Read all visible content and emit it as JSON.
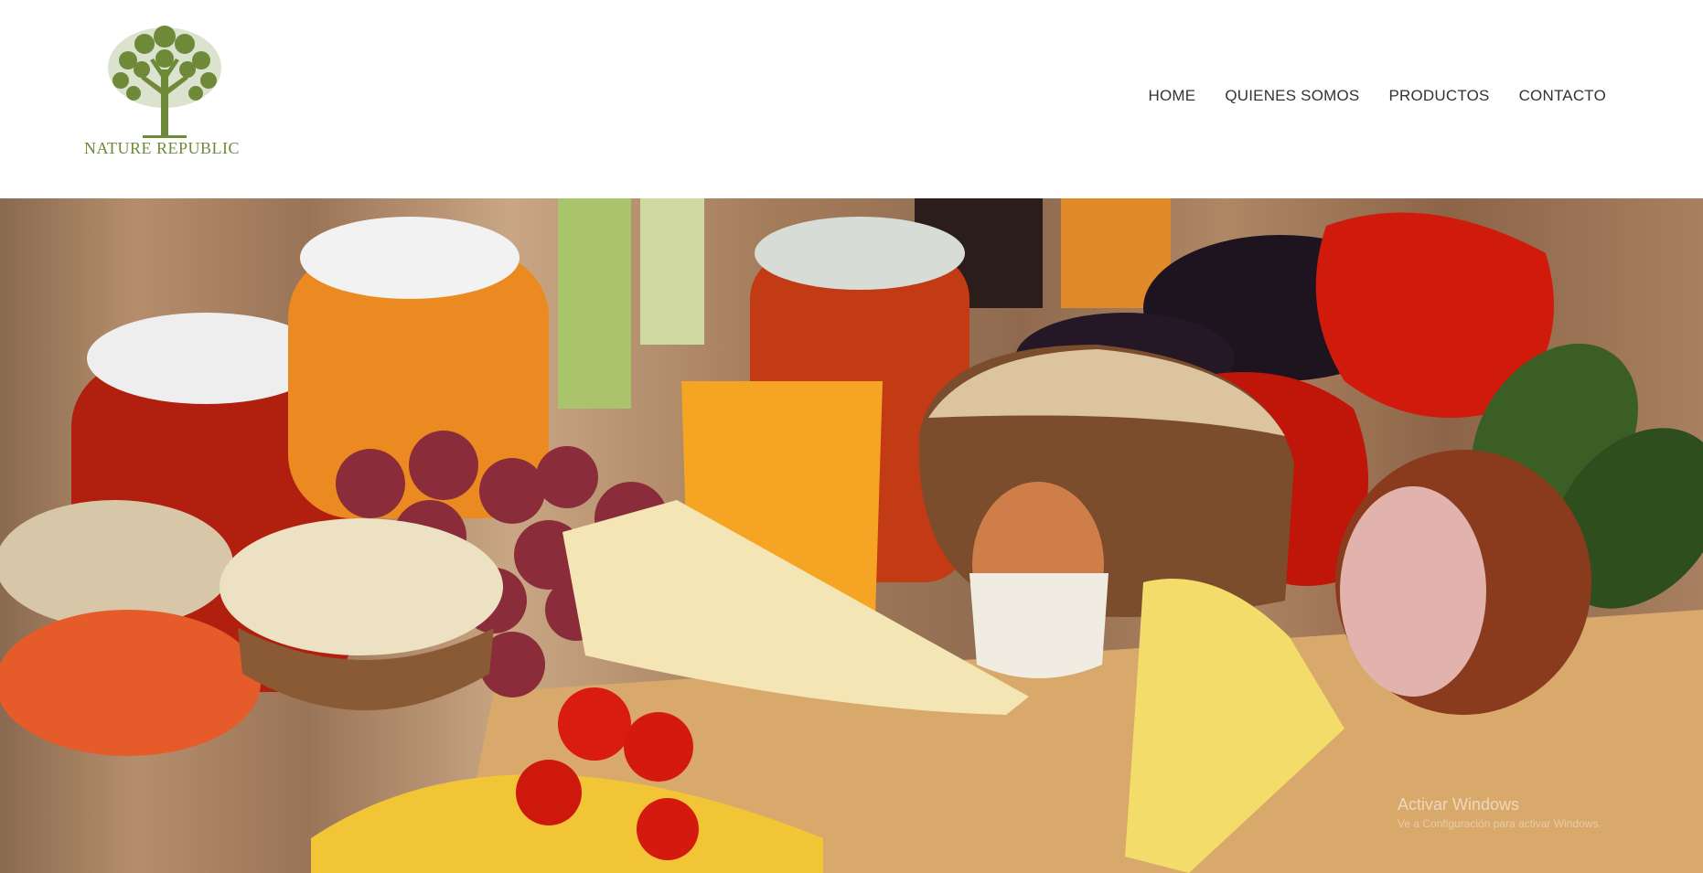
{
  "brand": {
    "name": "NATURE REPUBLIC",
    "logo_icon": "tree-icon",
    "color": "#6e8a38"
  },
  "nav": {
    "items": [
      "HOME",
      "QUIENES SOMOS",
      "PRODUCTOS",
      "CONTACTO"
    ]
  },
  "hero": {
    "image": "grocery-food-assortment"
  },
  "watermark": {
    "title": "Activar Windows",
    "subtitle": "Ve a Configuración para activar Windows."
  }
}
